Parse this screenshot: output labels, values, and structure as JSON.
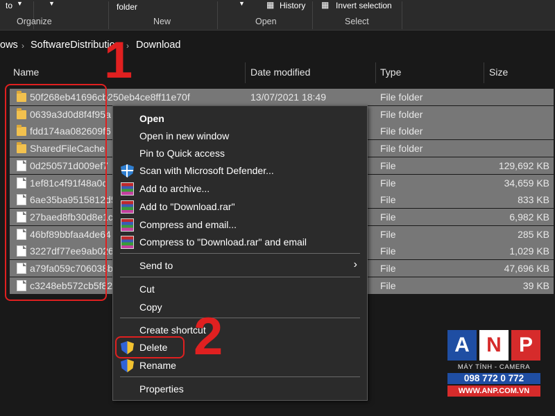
{
  "ribbon": {
    "to_label": "to",
    "folder_label": "folder",
    "history_label": "History",
    "invert_label": "Invert selection",
    "groups": [
      "Organize",
      "New",
      "Open",
      "Select"
    ]
  },
  "address": {
    "crumbs": [
      "ows",
      "SoftwareDistribution",
      "Download"
    ]
  },
  "columns": [
    "Name",
    "Date modified",
    "Type",
    "Size"
  ],
  "files": [
    {
      "name": "50f268eb41696cb250eb4ce8ff11e70f",
      "date": "13/07/2021 18:49",
      "type": "File folder",
      "size": "",
      "kind": "folder"
    },
    {
      "name": "0639a3d0d8f4f95a",
      "date": "",
      "type": "File folder",
      "size": "",
      "kind": "folder"
    },
    {
      "name": "fdd174aa082609f6",
      "date": "",
      "type": "File folder",
      "size": "",
      "kind": "folder"
    },
    {
      "name": "SharedFileCache",
      "date": "",
      "type": "File folder",
      "size": "",
      "kind": "folder"
    },
    {
      "name": "0d250571d009ef7",
      "date": "",
      "type": "File",
      "size": "129,692 KB",
      "kind": "file"
    },
    {
      "name": "1ef81c4f91f48a0c",
      "date": "",
      "type": "File",
      "size": "34,659 KB",
      "kind": "file"
    },
    {
      "name": "6ae35ba9515812d5",
      "date": "",
      "type": "File",
      "size": "833 KB",
      "kind": "file"
    },
    {
      "name": "27baed8fb30d8e1c",
      "date": "",
      "type": "File",
      "size": "6,982 KB",
      "kind": "file"
    },
    {
      "name": "46bf89bbfaa4de64",
      "date": "",
      "type": "File",
      "size": "285 KB",
      "kind": "file"
    },
    {
      "name": "3227df77ee9ab026",
      "date": "",
      "type": "File",
      "size": "1,029 KB",
      "kind": "file"
    },
    {
      "name": "a79fa059c706038b",
      "date": "",
      "type": "File",
      "size": "47,696 KB",
      "kind": "file"
    },
    {
      "name": "c3248eb572cb5f82",
      "date": "",
      "type": "File",
      "size": "39 KB",
      "kind": "file"
    }
  ],
  "menu": {
    "open": "Open",
    "open_new_window": "Open in new window",
    "pin_quick_access": "Pin to Quick access",
    "scan_defender": "Scan with Microsoft Defender...",
    "add_archive": "Add to archive...",
    "add_download_rar": "Add to \"Download.rar\"",
    "compress_email": "Compress and email...",
    "compress_download_email": "Compress to \"Download.rar\" and email",
    "send_to": "Send to",
    "cut": "Cut",
    "copy": "Copy",
    "create_shortcut": "Create shortcut",
    "delete": "Delete",
    "rename": "Rename",
    "properties": "Properties"
  },
  "annotations": {
    "step1": "1",
    "step2": "2"
  },
  "logo": {
    "letters": [
      "A",
      "N",
      "P"
    ],
    "subtitle": "MÁY TÍNH - CAMERA",
    "phone": "098 772 0 772",
    "website": "WWW.ANP.COM.VN"
  },
  "colors": {
    "background": "#191919",
    "selection": "#777777",
    "menu": "#2b2b2b",
    "annotation": "#e02020",
    "logo_a": "#1f4ea3",
    "logo_n": "#ffffff",
    "logo_p": "#d62b2b"
  }
}
